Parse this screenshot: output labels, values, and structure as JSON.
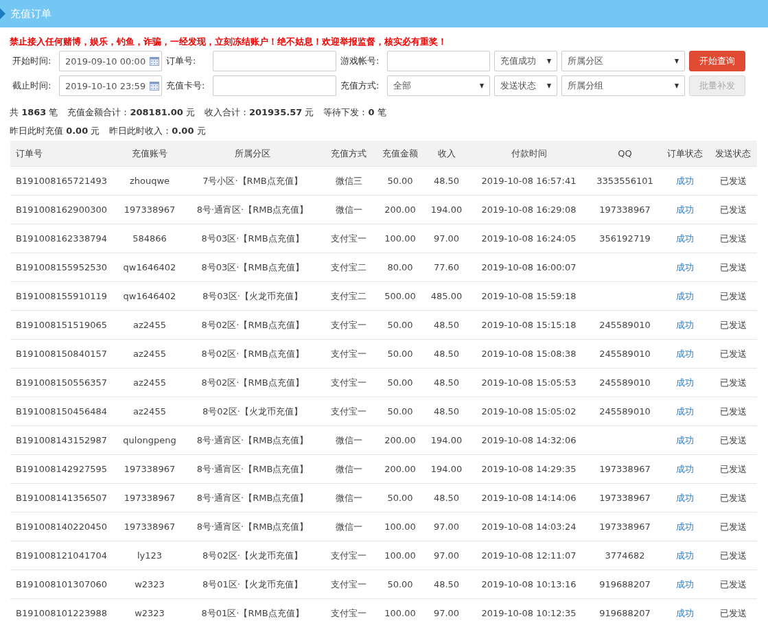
{
  "header": {
    "title": "充值订单"
  },
  "notice": "禁止接入任何赌博，娱乐，钓鱼，诈骗，一经发现，立刻冻结账户！绝不姑息！欢迎举报监督，核实必有重奖！",
  "filters": [
    [
      {
        "kind": "label",
        "text": "开始时间:"
      },
      {
        "kind": "date",
        "value": "2019-09-10 00:00"
      },
      {
        "kind": "label",
        "text": "订单号:"
      },
      {
        "kind": "text"
      },
      {
        "kind": "label",
        "text": "游戏帐号:"
      },
      {
        "kind": "text"
      },
      {
        "kind": "select",
        "value": "充值成功"
      },
      {
        "kind": "select",
        "value": "所属分区"
      },
      {
        "kind": "button",
        "text": "开始查询",
        "disabled": false
      }
    ],
    [
      {
        "kind": "label",
        "text": "截止时间:"
      },
      {
        "kind": "date",
        "value": "2019-10-10 23:59"
      },
      {
        "kind": "label",
        "text": "充值卡号:"
      },
      {
        "kind": "text"
      },
      {
        "kind": "label",
        "text": "充值方式:"
      },
      {
        "kind": "select",
        "value": "全部"
      },
      {
        "kind": "select",
        "value": "发送状态"
      },
      {
        "kind": "select",
        "value": "所属分组"
      },
      {
        "kind": "button",
        "text": "批量补发",
        "disabled": true
      }
    ]
  ],
  "stats": [
    [
      "共 **1863** 笔",
      "充值金额合计：**208181.00** 元",
      "收入合计：**201935.57** 元",
      "等待下发：**0** 笔"
    ],
    [
      "昨日此时充值 **0.00** 元",
      "昨日此时收入：**0.00** 元"
    ]
  ],
  "table": {
    "columns": [
      "订单号",
      "充值账号",
      "所属分区",
      "充值方式",
      "充值金额",
      "收入",
      "付款时间",
      "QQ",
      "订单状态",
      "发送状态"
    ],
    "rows": [
      [
        "B191008165721493",
        "zhouqwe",
        "7号小区·【RMB点充值】",
        "微信三",
        "50.00",
        "48.50",
        "2019-10-08 16:57:41",
        "3353556101",
        "成功",
        "已发送"
      ],
      [
        "B191008162900300",
        "197338967",
        "8号·通宵区·【RMB点充值】",
        "微信一",
        "200.00",
        "194.00",
        "2019-10-08 16:29:08",
        "197338967",
        "成功",
        "已发送"
      ],
      [
        "B191008162338794",
        "584866",
        "8号03区·【RMB点充值】",
        "支付宝一",
        "100.00",
        "97.00",
        "2019-10-08 16:24:05",
        "356192719",
        "成功",
        "已发送"
      ],
      [
        "B191008155952530",
        "qw1646402",
        "8号03区·【RMB点充值】",
        "支付宝二",
        "80.00",
        "77.60",
        "2019-10-08 16:00:07",
        null,
        "成功",
        "已发送"
      ],
      [
        "B191008155910119",
        "qw1646402",
        "8号03区·【火龙币充值】",
        "支付宝二",
        "500.00",
        "485.00",
        "2019-10-08 15:59:18",
        null,
        "成功",
        "已发送"
      ],
      [
        "B191008151519065",
        "az2455",
        "8号02区·【RMB点充值】",
        "支付宝一",
        "50.00",
        "48.50",
        "2019-10-08 15:15:18",
        "245589010",
        "成功",
        "已发送"
      ],
      [
        "B191008150840157",
        "az2455",
        "8号02区·【RMB点充值】",
        "支付宝一",
        "50.00",
        "48.50",
        "2019-10-08 15:08:38",
        "245589010",
        "成功",
        "已发送"
      ],
      [
        "B191008150556357",
        "az2455",
        "8号02区·【RMB点充值】",
        "支付宝一",
        "50.00",
        "48.50",
        "2019-10-08 15:05:53",
        "245589010",
        "成功",
        "已发送"
      ],
      [
        "B191008150456484",
        "az2455",
        "8号02区·【火龙币充值】",
        "支付宝一",
        "50.00",
        "48.50",
        "2019-10-08 15:05:02",
        "245589010",
        "成功",
        "已发送"
      ],
      [
        "B191008143152987",
        "qulongpeng",
        "8号·通宵区·【RMB点充值】",
        "微信一",
        "200.00",
        "194.00",
        "2019-10-08 14:32:06",
        null,
        "成功",
        "已发送"
      ],
      [
        "B191008142927595",
        "197338967",
        "8号·通宵区·【RMB点充值】",
        "微信一",
        "200.00",
        "194.00",
        "2019-10-08 14:29:35",
        "197338967",
        "成功",
        "已发送"
      ],
      [
        "B191008141356507",
        "197338967",
        "8号·通宵区·【RMB点充值】",
        "微信一",
        "50.00",
        "48.50",
        "2019-10-08 14:14:06",
        "197338967",
        "成功",
        "已发送"
      ],
      [
        "B191008140220450",
        "197338967",
        "8号·通宵区·【RMB点充值】",
        "微信一",
        "100.00",
        "97.00",
        "2019-10-08 14:03:24",
        "197338967",
        "成功",
        "已发送"
      ],
      [
        "B191008121041704",
        "ly123",
        "8号02区·【火龙币充值】",
        "支付宝一",
        "100.00",
        "97.00",
        "2019-10-08 12:11:07",
        "3774682",
        "成功",
        "已发送"
      ],
      [
        "B191008101307060",
        "w2323",
        "8号01区·【火龙币充值】",
        "支付宝一",
        "50.00",
        "48.50",
        "2019-10-08 10:13:16",
        "919688207",
        "成功",
        "已发送"
      ],
      [
        "B191008101223988",
        "w2323",
        "8号01区·【RMB点充值】",
        "支付宝一",
        "100.00",
        "97.00",
        "2019-10-08 10:12:35",
        "919688207",
        "成功",
        "已发送"
      ]
    ]
  }
}
